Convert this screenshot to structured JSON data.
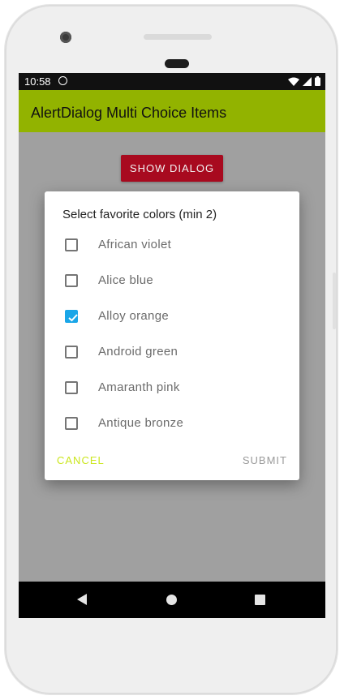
{
  "status_bar": {
    "time": "10:58"
  },
  "app": {
    "title": "AlertDialog Multi Choice Items",
    "accent": "#92b300"
  },
  "main": {
    "show_dialog_label": "SHOW DIALOG"
  },
  "dialog": {
    "title": "Select favorite colors (min 2)",
    "options": [
      {
        "label": "African violet",
        "checked": false
      },
      {
        "label": "Alice blue",
        "checked": false
      },
      {
        "label": "Alloy orange",
        "checked": true
      },
      {
        "label": "Android green",
        "checked": false
      },
      {
        "label": "Amaranth pink",
        "checked": false
      },
      {
        "label": "Antique bronze",
        "checked": false
      }
    ],
    "cancel_label": "CANCEL",
    "submit_label": "SUBMIT"
  },
  "colors": {
    "button_bg": "#a80a1f",
    "checkbox_checked": "#1aa6e8",
    "cancel_text": "#cbe61e"
  },
  "icons": [
    "camera-icon",
    "wifi-icon",
    "signal-icon",
    "battery-icon",
    "back-icon",
    "home-icon",
    "recents-icon"
  ]
}
